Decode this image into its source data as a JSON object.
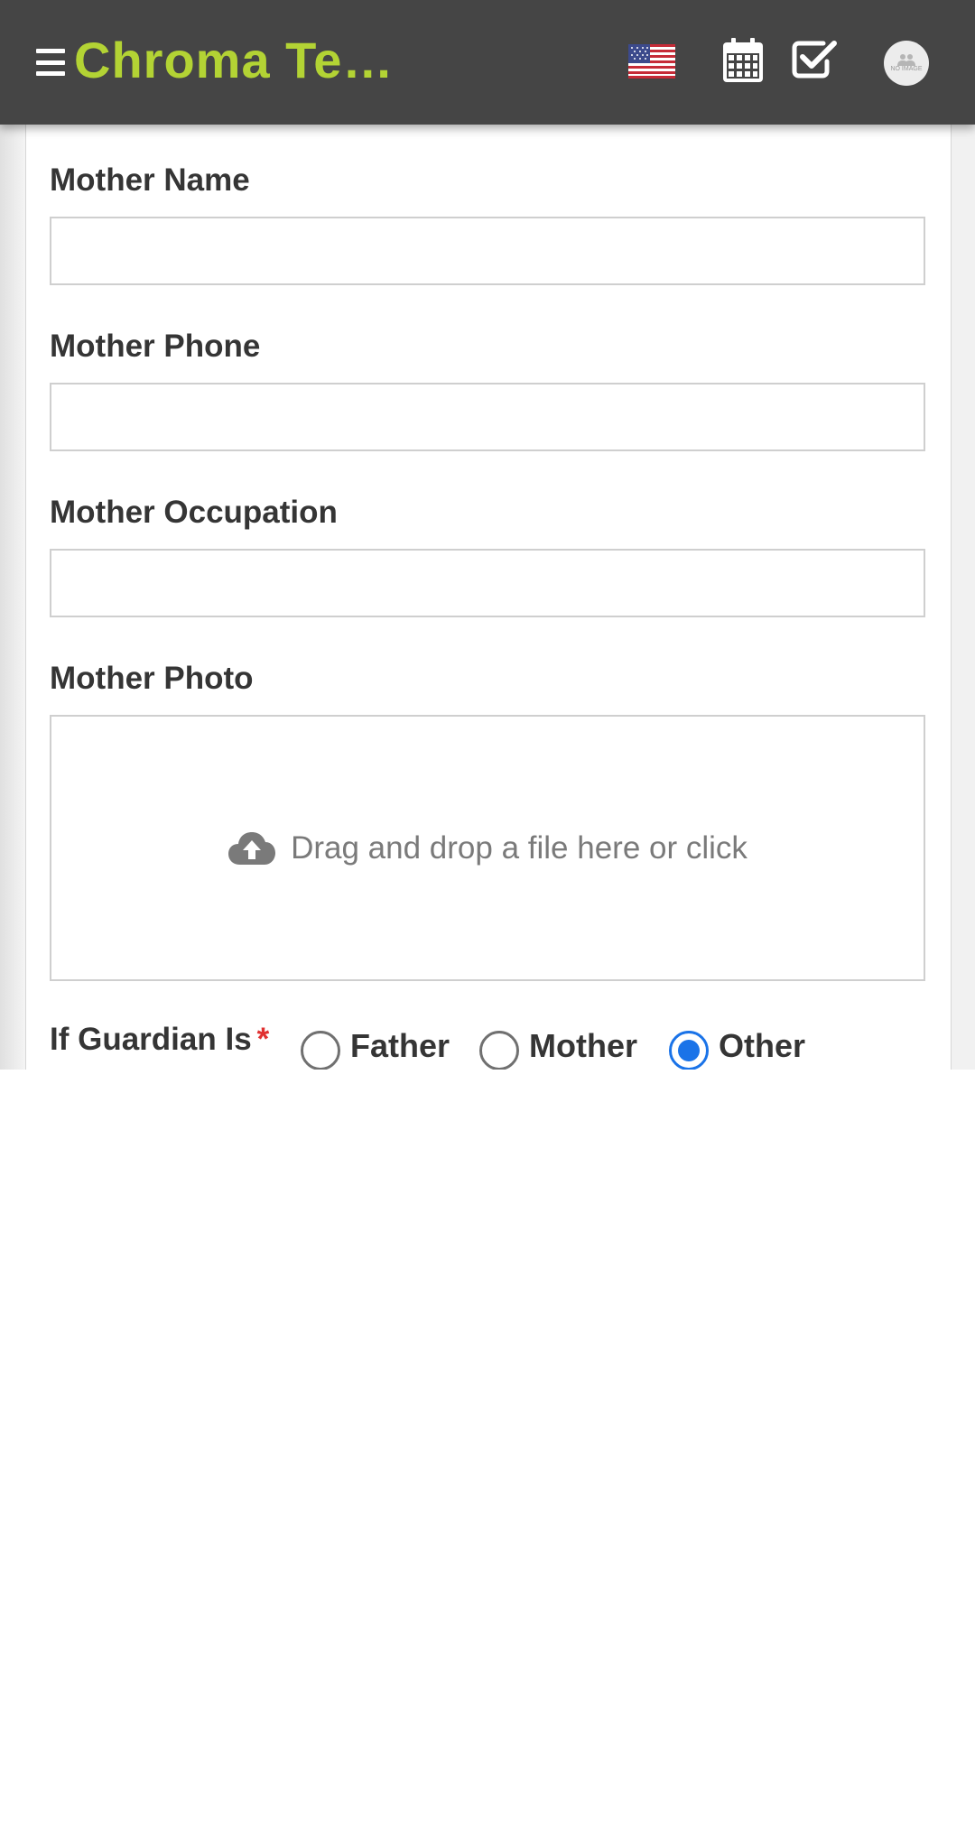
{
  "header": {
    "app_title": "Chroma Te…",
    "icons": [
      "menu-icon",
      "us-flag-icon",
      "calendar-icon",
      "checkbox-icon",
      "avatar"
    ],
    "avatar_text": "NO IMAGE",
    "accent_color": "#b3d334",
    "bar_color": "#454545"
  },
  "form": {
    "mother_name": {
      "label": "Mother Name",
      "value": ""
    },
    "mother_phone": {
      "label": "Mother Phone",
      "value": ""
    },
    "mother_occupation": {
      "label": "Mother Occupation",
      "value": ""
    },
    "mother_photo": {
      "label": "Mother Photo",
      "dropzone_text": "Drag and drop a file here or click",
      "icon": "cloud-upload-icon"
    },
    "guardian": {
      "label": "If Guardian Is",
      "required_mark": "*",
      "options": [
        {
          "label": "Father",
          "checked": false
        },
        {
          "label": "Mother",
          "checked": false
        },
        {
          "label": "Other",
          "checked": true
        }
      ],
      "selected": "Other",
      "selected_color": "#1a73e8"
    }
  }
}
